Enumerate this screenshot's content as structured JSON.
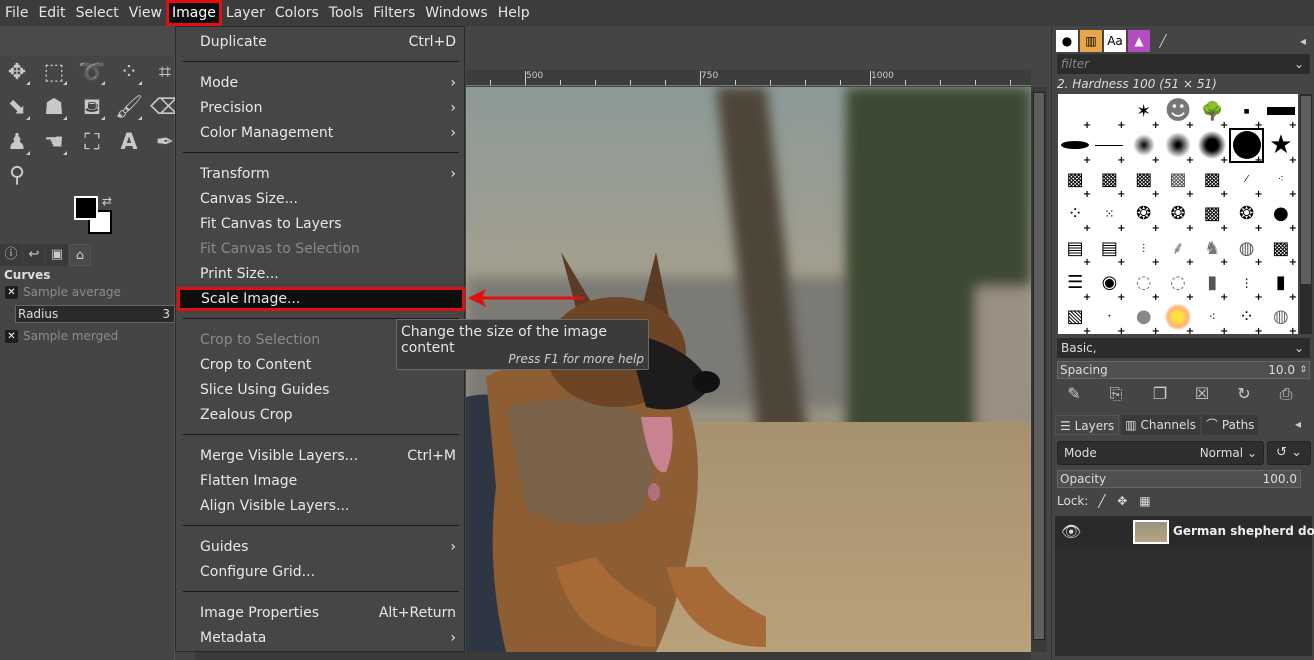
{
  "menubar": {
    "items": [
      "File",
      "Edit",
      "Select",
      "View",
      "Image",
      "Layer",
      "Colors",
      "Tools",
      "Filters",
      "Windows",
      "Help"
    ],
    "active": "Image"
  },
  "image_menu": {
    "items": [
      {
        "label": "Duplicate",
        "shortcut": "Ctrl+D"
      },
      {
        "label": "Mode",
        "submenu": true
      },
      {
        "label": "Precision",
        "submenu": true
      },
      {
        "label": "Color Management",
        "submenu": true
      },
      {
        "label": "Transform",
        "submenu": true
      },
      {
        "label": "Canvas Size..."
      },
      {
        "label": "Fit Canvas to Layers"
      },
      {
        "label": "Fit Canvas to Selection",
        "disabled": true
      },
      {
        "label": "Print Size..."
      },
      {
        "label": "Scale Image...",
        "highlighted": true
      },
      {
        "label": "Crop to Selection",
        "disabled": true
      },
      {
        "label": "Crop to Content"
      },
      {
        "label": "Slice Using Guides"
      },
      {
        "label": "Zealous Crop"
      },
      {
        "label": "Merge Visible Layers...",
        "shortcut": "Ctrl+M"
      },
      {
        "label": "Flatten Image"
      },
      {
        "label": "Align Visible Layers..."
      },
      {
        "label": "Guides",
        "submenu": true
      },
      {
        "label": "Configure Grid..."
      },
      {
        "label": "Image Properties",
        "shortcut": "Alt+Return"
      },
      {
        "label": "Metadata",
        "submenu": true
      }
    ],
    "submenu_glyph": "›"
  },
  "tooltip": {
    "text": "Change the size of the image content",
    "hint": "Press F1 for more help"
  },
  "toolbox": {
    "tools": [
      "move-tool",
      "rect-select-tool",
      "free-select-tool",
      "fuzzy-select-tool",
      "crop-tool",
      "unified-transform-tool",
      "warp-transform-tool",
      "bucket-fill-tool",
      "paintbrush-tool",
      "eraser-tool",
      "clone-tool",
      "smudge-tool",
      "paths-tool",
      "text-tool",
      "color-picker-tool",
      "zoom-tool"
    ],
    "tool_options": {
      "title": "Curves",
      "sample_average": {
        "label": "Sample average",
        "checked": true
      },
      "radius": {
        "label": "Radius",
        "value": "3"
      },
      "sample_merged": {
        "label": "Sample merged",
        "checked": true
      }
    }
  },
  "ruler": {
    "labels": [
      "500",
      "750",
      "1000"
    ]
  },
  "brushes": {
    "filter_placeholder": "filter",
    "selected_name": "2. Hardness 100 (51 × 51)",
    "preset": "Basic,",
    "spacing": {
      "label": "Spacing",
      "value": "10.0"
    }
  },
  "layers": {
    "tabs": [
      "Layers",
      "Channels",
      "Paths"
    ],
    "mode": {
      "label": "Mode",
      "value": "Normal"
    },
    "opacity": {
      "label": "Opacity",
      "value": "100.0"
    },
    "lock_label": "Lock:",
    "layer_name": "German shepherd dog.jp"
  },
  "colors": {
    "highlight": "#e01010",
    "menu_bg": "#464646"
  }
}
